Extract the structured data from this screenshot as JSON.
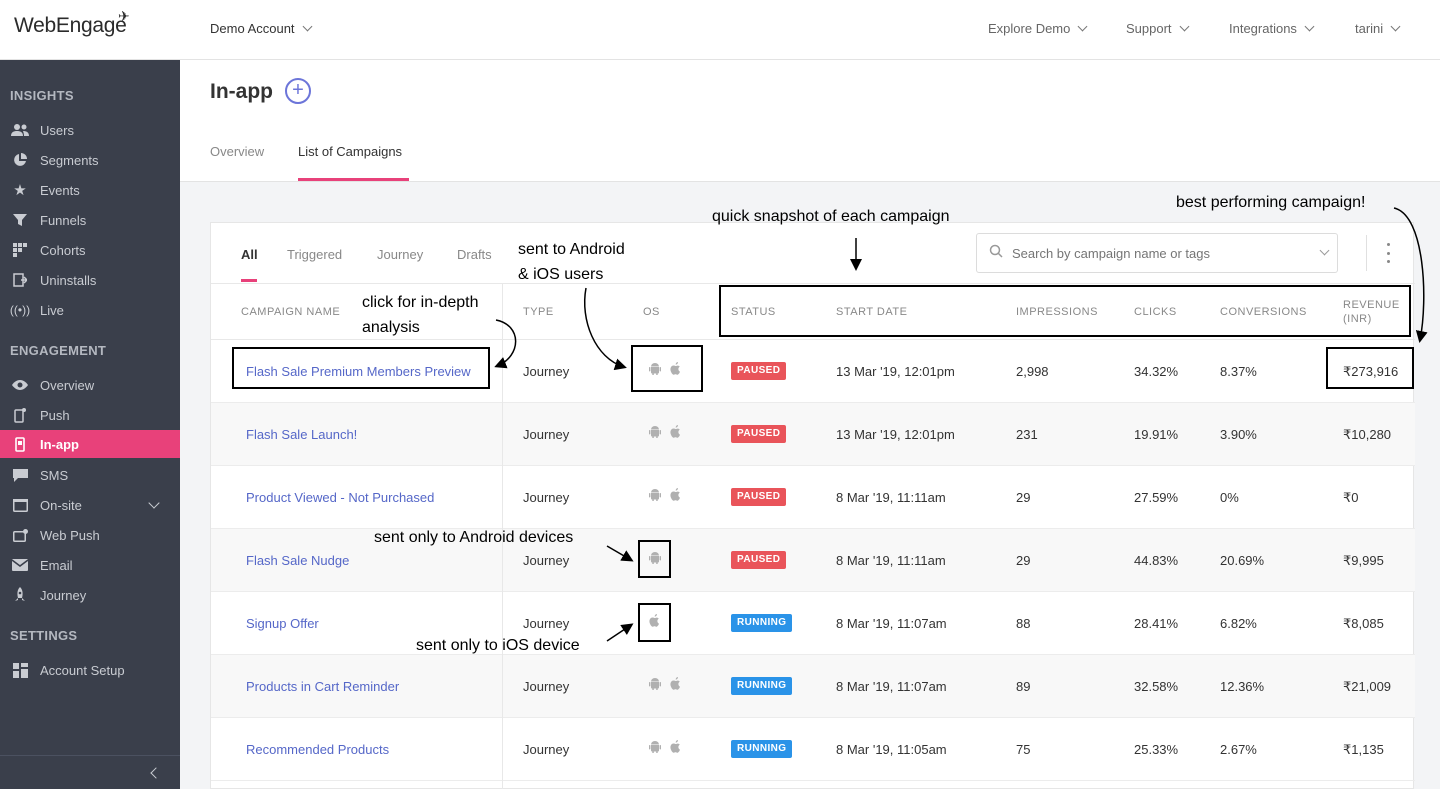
{
  "header": {
    "logo": "WebEngage",
    "account": "Demo Account",
    "nav": [
      {
        "label": "Explore Demo"
      },
      {
        "label": "Support"
      },
      {
        "label": "Integrations"
      },
      {
        "label": "tarini"
      }
    ]
  },
  "sidebar": {
    "sections": [
      {
        "title": "INSIGHTS",
        "items": [
          {
            "label": "Users",
            "icon": "users-icon"
          },
          {
            "label": "Segments",
            "icon": "pie-chart-icon"
          },
          {
            "label": "Events",
            "icon": "star-icon"
          },
          {
            "label": "Funnels",
            "icon": "funnel-icon"
          },
          {
            "label": "Cohorts",
            "icon": "grid-icon"
          },
          {
            "label": "Uninstalls",
            "icon": "uninstall-icon"
          },
          {
            "label": "Live",
            "icon": "broadcast-icon"
          }
        ]
      },
      {
        "title": "ENGAGEMENT",
        "items": [
          {
            "label": "Overview",
            "icon": "eye-icon"
          },
          {
            "label": "Push",
            "icon": "mobile-push-icon"
          },
          {
            "label": "In-app",
            "icon": "mobile-icon",
            "active": true
          },
          {
            "label": "SMS",
            "icon": "chat-icon"
          },
          {
            "label": "On-site",
            "icon": "window-icon",
            "expandable": true
          },
          {
            "label": "Web Push",
            "icon": "web-push-icon"
          },
          {
            "label": "Email",
            "icon": "envelope-icon"
          },
          {
            "label": "Journey",
            "icon": "rocket-icon"
          }
        ]
      },
      {
        "title": "SETTINGS",
        "items": [
          {
            "label": "Account Setup",
            "icon": "settings-grid-icon"
          }
        ]
      }
    ]
  },
  "page": {
    "title": "In-app",
    "tabs": [
      {
        "label": "Overview"
      },
      {
        "label": "List of Campaigns",
        "active": true
      }
    ]
  },
  "filters": {
    "tabs": [
      {
        "label": "All",
        "active": true
      },
      {
        "label": "Triggered"
      },
      {
        "label": "Journey"
      },
      {
        "label": "Drafts"
      }
    ],
    "search_placeholder": "Search by campaign name or tags"
  },
  "table": {
    "columns": [
      "CAMPAIGN NAME",
      "TYPE",
      "OS",
      "STATUS",
      "START DATE",
      "IMPRESSIONS",
      "CLICKS",
      "CONVERSIONS",
      "REVENUE",
      "(INR)"
    ],
    "rows": [
      {
        "name": "Flash Sale Premium Members Preview",
        "type": "Journey",
        "os": [
          "android",
          "ios"
        ],
        "status": "PAUSED",
        "start": "13 Mar '19, 12:01pm",
        "impressions": "2,998",
        "clicks": "34.32%",
        "conversions": "8.37%",
        "revenue": "₹273,916"
      },
      {
        "name": "Flash Sale Launch!",
        "type": "Journey",
        "os": [
          "android",
          "ios"
        ],
        "status": "PAUSED",
        "start": "13 Mar '19, 12:01pm",
        "impressions": "231",
        "clicks": "19.91%",
        "conversions": "3.90%",
        "revenue": "₹10,280"
      },
      {
        "name": "Product Viewed - Not Purchased",
        "type": "Journey",
        "os": [
          "android",
          "ios"
        ],
        "status": "PAUSED",
        "start": "8 Mar '19, 11:11am",
        "impressions": "29",
        "clicks": "27.59%",
        "conversions": "0%",
        "revenue": "₹0"
      },
      {
        "name": "Flash Sale Nudge",
        "type": "Journey",
        "os": [
          "android"
        ],
        "status": "PAUSED",
        "start": "8 Mar '19, 11:11am",
        "impressions": "29",
        "clicks": "44.83%",
        "conversions": "20.69%",
        "revenue": "₹9,995"
      },
      {
        "name": "Signup Offer",
        "type": "Journey",
        "os": [
          "ios"
        ],
        "status": "RUNNING",
        "start": "8 Mar '19, 11:07am",
        "impressions": "88",
        "clicks": "28.41%",
        "conversions": "6.82%",
        "revenue": "₹8,085"
      },
      {
        "name": "Products in Cart Reminder",
        "type": "Journey",
        "os": [
          "android",
          "ios"
        ],
        "status": "RUNNING",
        "start": "8 Mar '19, 11:07am",
        "impressions": "89",
        "clicks": "32.58%",
        "conversions": "12.36%",
        "revenue": "₹21,009"
      },
      {
        "name": "Recommended Products",
        "type": "Journey",
        "os": [
          "android",
          "ios"
        ],
        "status": "RUNNING",
        "start": "8 Mar '19, 11:05am",
        "impressions": "75",
        "clicks": "25.33%",
        "conversions": "2.67%",
        "revenue": "₹1,135"
      }
    ]
  },
  "annotations": {
    "snapshot": "quick snapshot of each campaign",
    "best": "best performing campaign!",
    "android_ios_1": "sent to Android",
    "android_ios_2": "& iOS users",
    "click_1": "click for in-depth",
    "click_2": "analysis",
    "android_only": "sent only to Android devices",
    "ios_only": "sent only to iOS device"
  },
  "colors": {
    "accent": "#e8417a",
    "sidebar": "#3a3f4b",
    "link": "#5567c8",
    "paused": "#e9545a",
    "running": "#2a93e8"
  }
}
